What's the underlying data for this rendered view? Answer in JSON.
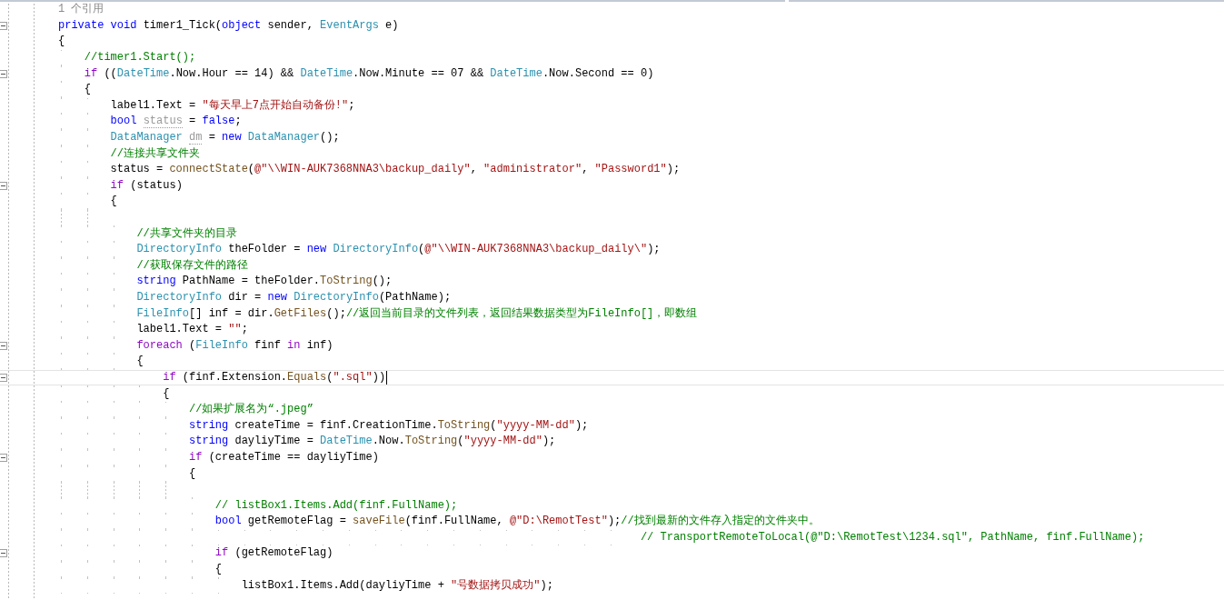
{
  "editor": {
    "lines": [
      {
        "kind": "codelens",
        "foldable": false,
        "current": false,
        "text": "1 个引用"
      },
      {
        "kind": "code",
        "foldable": true,
        "current": false,
        "tokens": [
          {
            "kind": "keyword",
            "text": "private void "
          },
          {
            "kind": "plain",
            "text": "timer1_Tick("
          },
          {
            "kind": "keyword",
            "text": "object"
          },
          {
            "kind": "plain",
            "text": " sender, "
          },
          {
            "kind": "type",
            "text": "EventArgs"
          },
          {
            "kind": "plain",
            "text": " e)"
          }
        ]
      },
      {
        "kind": "code",
        "foldable": false,
        "current": false,
        "tokens": [
          {
            "kind": "plain",
            "text": "{"
          }
        ]
      },
      {
        "kind": "code",
        "foldable": false,
        "current": false,
        "tokens": [
          {
            "kind": "comment",
            "text": "    //timer1.Start();"
          }
        ]
      },
      {
        "kind": "code",
        "foldable": true,
        "current": false,
        "tokens": [
          {
            "kind": "control",
            "text": "    if"
          },
          {
            "kind": "plain",
            "text": " (("
          },
          {
            "kind": "type",
            "text": "DateTime"
          },
          {
            "kind": "plain",
            "text": ".Now.Hour == 14) && "
          },
          {
            "kind": "type",
            "text": "DateTime"
          },
          {
            "kind": "plain",
            "text": ".Now.Minute == 07 && "
          },
          {
            "kind": "type",
            "text": "DateTime"
          },
          {
            "kind": "plain",
            "text": ".Now.Second == 0)"
          }
        ]
      },
      {
        "kind": "code",
        "foldable": false,
        "current": false,
        "tokens": [
          {
            "kind": "plain",
            "text": "    {"
          }
        ]
      },
      {
        "kind": "code",
        "foldable": false,
        "current": false,
        "tokens": [
          {
            "kind": "plain",
            "text": "        label1.Text = "
          },
          {
            "kind": "string",
            "text": "\"每天早上7点开始自动备份!\""
          },
          {
            "kind": "plain",
            "text": ";"
          }
        ]
      },
      {
        "kind": "code",
        "foldable": false,
        "current": false,
        "tokens": [
          {
            "kind": "keyword",
            "text": "        bool "
          },
          {
            "kind": "unused",
            "text": "status"
          },
          {
            "kind": "plain",
            "text": " = "
          },
          {
            "kind": "keyword",
            "text": "false"
          },
          {
            "kind": "plain",
            "text": ";"
          }
        ]
      },
      {
        "kind": "code",
        "foldable": false,
        "current": false,
        "tokens": [
          {
            "kind": "type",
            "text": "        DataManager "
          },
          {
            "kind": "unused",
            "text": "dm"
          },
          {
            "kind": "plain",
            "text": " = "
          },
          {
            "kind": "keyword",
            "text": "new "
          },
          {
            "kind": "type",
            "text": "DataManager"
          },
          {
            "kind": "plain",
            "text": "();"
          }
        ]
      },
      {
        "kind": "code",
        "foldable": false,
        "current": false,
        "tokens": [
          {
            "kind": "comment",
            "text": "        //连接共享文件夹"
          }
        ]
      },
      {
        "kind": "code",
        "foldable": false,
        "current": false,
        "tokens": [
          {
            "kind": "plain",
            "text": "        status = "
          },
          {
            "kind": "method",
            "text": "connectState"
          },
          {
            "kind": "plain",
            "text": "("
          },
          {
            "kind": "string",
            "text": "@\"\\\\WIN-AUK7368NNA3\\backup_daily\""
          },
          {
            "kind": "plain",
            "text": ", "
          },
          {
            "kind": "string",
            "text": "\"administrator\""
          },
          {
            "kind": "plain",
            "text": ", "
          },
          {
            "kind": "string",
            "text": "\"Password1\""
          },
          {
            "kind": "plain",
            "text": ");"
          }
        ]
      },
      {
        "kind": "code",
        "foldable": true,
        "current": false,
        "tokens": [
          {
            "kind": "control",
            "text": "        if"
          },
          {
            "kind": "plain",
            "text": " (status)"
          }
        ]
      },
      {
        "kind": "code",
        "foldable": false,
        "current": false,
        "tokens": [
          {
            "kind": "plain",
            "text": "        {"
          }
        ]
      },
      {
        "kind": "code",
        "foldable": false,
        "current": false
      },
      {
        "kind": "code",
        "foldable": false,
        "current": false,
        "tokens": [
          {
            "kind": "comment",
            "text": "            //共享文件夹的目录"
          }
        ]
      },
      {
        "kind": "code",
        "foldable": false,
        "current": false,
        "tokens": [
          {
            "kind": "type",
            "text": "            DirectoryInfo"
          },
          {
            "kind": "plain",
            "text": " theFolder = "
          },
          {
            "kind": "keyword",
            "text": "new "
          },
          {
            "kind": "type",
            "text": "DirectoryInfo"
          },
          {
            "kind": "plain",
            "text": "("
          },
          {
            "kind": "string",
            "text": "@\"\\\\WIN-AUK7368NNA3\\backup_daily\\\""
          },
          {
            "kind": "plain",
            "text": ");"
          }
        ]
      },
      {
        "kind": "code",
        "foldable": false,
        "current": false,
        "tokens": [
          {
            "kind": "comment",
            "text": "            //获取保存文件的路径"
          }
        ]
      },
      {
        "kind": "code",
        "foldable": false,
        "current": false,
        "tokens": [
          {
            "kind": "keyword",
            "text": "            string"
          },
          {
            "kind": "plain",
            "text": " PathName = theFolder."
          },
          {
            "kind": "method",
            "text": "ToString"
          },
          {
            "kind": "plain",
            "text": "();"
          }
        ]
      },
      {
        "kind": "code",
        "foldable": false,
        "current": false,
        "tokens": [
          {
            "kind": "type",
            "text": "            DirectoryInfo"
          },
          {
            "kind": "plain",
            "text": " dir = "
          },
          {
            "kind": "keyword",
            "text": "new "
          },
          {
            "kind": "type",
            "text": "DirectoryInfo"
          },
          {
            "kind": "plain",
            "text": "(PathName);"
          }
        ]
      },
      {
        "kind": "code",
        "foldable": false,
        "current": false,
        "tokens": [
          {
            "kind": "type",
            "text": "            FileInfo"
          },
          {
            "kind": "plain",
            "text": "[] inf = dir."
          },
          {
            "kind": "method",
            "text": "GetFiles"
          },
          {
            "kind": "plain",
            "text": "();"
          },
          {
            "kind": "comment",
            "text": "//返回当前目录的文件列表，返回结果数据类型为FileInfo[]，即数组"
          }
        ]
      },
      {
        "kind": "code",
        "foldable": false,
        "current": false,
        "tokens": [
          {
            "kind": "plain",
            "text": "            label1.Text = "
          },
          {
            "kind": "string",
            "text": "\"\""
          },
          {
            "kind": "plain",
            "text": ";"
          }
        ]
      },
      {
        "kind": "code",
        "foldable": true,
        "current": false,
        "tokens": [
          {
            "kind": "control",
            "text": "            foreach"
          },
          {
            "kind": "plain",
            "text": " ("
          },
          {
            "kind": "type",
            "text": "FileInfo"
          },
          {
            "kind": "plain",
            "text": " finf "
          },
          {
            "kind": "control",
            "text": "in"
          },
          {
            "kind": "plain",
            "text": " inf)"
          }
        ]
      },
      {
        "kind": "code",
        "foldable": false,
        "current": false,
        "tokens": [
          {
            "kind": "plain",
            "text": "            {"
          }
        ]
      },
      {
        "kind": "code",
        "foldable": true,
        "current": true,
        "tokens": [
          {
            "kind": "control",
            "text": "                if"
          },
          {
            "kind": "plain",
            "text": " (finf.Extension."
          },
          {
            "kind": "method",
            "text": "Equals"
          },
          {
            "kind": "plain",
            "text": "("
          },
          {
            "kind": "string",
            "text": "\".sql\""
          },
          {
            "kind": "plain",
            "text": "))"
          }
        ]
      },
      {
        "kind": "code",
        "foldable": false,
        "current": false,
        "tokens": [
          {
            "kind": "plain",
            "text": "                {"
          }
        ]
      },
      {
        "kind": "code",
        "foldable": false,
        "current": false,
        "tokens": [
          {
            "kind": "comment",
            "text": "                    //如果扩展名为“.jpeg”"
          }
        ]
      },
      {
        "kind": "code",
        "foldable": false,
        "current": false,
        "tokens": [
          {
            "kind": "keyword",
            "text": "                    string"
          },
          {
            "kind": "plain",
            "text": " createTime = finf.CreationTime."
          },
          {
            "kind": "method",
            "text": "ToString"
          },
          {
            "kind": "plain",
            "text": "("
          },
          {
            "kind": "string",
            "text": "\"yyyy-MM-dd\""
          },
          {
            "kind": "plain",
            "text": ");"
          }
        ]
      },
      {
        "kind": "code",
        "foldable": false,
        "current": false,
        "tokens": [
          {
            "kind": "keyword",
            "text": "                    string"
          },
          {
            "kind": "plain",
            "text": " dayliyTime = "
          },
          {
            "kind": "type",
            "text": "DateTime"
          },
          {
            "kind": "plain",
            "text": ".Now."
          },
          {
            "kind": "method",
            "text": "ToString"
          },
          {
            "kind": "plain",
            "text": "("
          },
          {
            "kind": "string",
            "text": "\"yyyy-MM-dd\""
          },
          {
            "kind": "plain",
            "text": ");"
          }
        ]
      },
      {
        "kind": "code",
        "foldable": true,
        "current": false,
        "tokens": [
          {
            "kind": "control",
            "text": "                    if"
          },
          {
            "kind": "plain",
            "text": " (createTime == dayliyTime)"
          }
        ]
      },
      {
        "kind": "code",
        "foldable": false,
        "current": false,
        "tokens": [
          {
            "kind": "plain",
            "text": "                    {"
          }
        ]
      },
      {
        "kind": "code",
        "foldable": false,
        "current": false
      },
      {
        "kind": "code",
        "foldable": false,
        "current": false,
        "tokens": [
          {
            "kind": "comment",
            "text": "                        // listBox1.Items.Add(finf.FullName);"
          }
        ]
      },
      {
        "kind": "code",
        "foldable": false,
        "current": false,
        "tokens": [
          {
            "kind": "keyword",
            "text": "                        bool"
          },
          {
            "kind": "plain",
            "text": " getRemoteFlag = "
          },
          {
            "kind": "method",
            "text": "saveFile"
          },
          {
            "kind": "plain",
            "text": "(finf.FullName, "
          },
          {
            "kind": "string",
            "text": "@\"D:\\RemotTest\""
          },
          {
            "kind": "plain",
            "text": ");"
          },
          {
            "kind": "comment",
            "text": "//找到最新的文件存入指定的文件夹中。"
          }
        ]
      },
      {
        "kind": "code",
        "foldable": false,
        "current": false,
        "tokens": [
          {
            "kind": "comment",
            "text": "                                                                                         // TransportRemoteToLocal(@\"D:\\RemotTest\\1234.sql\", PathName, finf.FullName);"
          }
        ]
      },
      {
        "kind": "code",
        "foldable": true,
        "current": false,
        "tokens": [
          {
            "kind": "control",
            "text": "                        if"
          },
          {
            "kind": "plain",
            "text": " (getRemoteFlag)"
          }
        ]
      },
      {
        "kind": "code",
        "foldable": false,
        "current": false,
        "tokens": [
          {
            "kind": "plain",
            "text": "                        {"
          }
        ]
      },
      {
        "kind": "code",
        "foldable": false,
        "current": false,
        "tokens": [
          {
            "kind": "plain",
            "text": "                            listBox1.Items.Add(dayliyTime + "
          },
          {
            "kind": "string",
            "text": "\"号数据拷贝成功\""
          },
          {
            "kind": "plain",
            "text": ");"
          }
        ]
      }
    ]
  }
}
